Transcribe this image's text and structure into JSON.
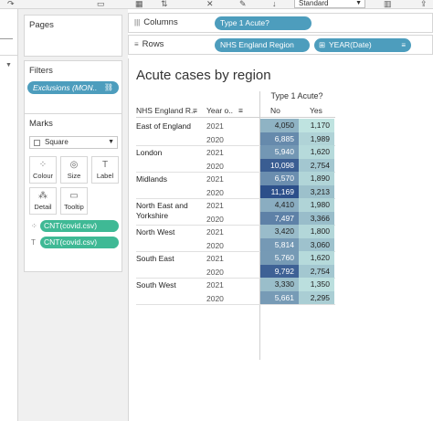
{
  "toolbar": {
    "fit_select": "Standard"
  },
  "cards": {
    "pages_title": "Pages",
    "filters_title": "Filters",
    "filter_pill": "Exclusions (MON..",
    "marks_title": "Marks",
    "mark_type": "Square",
    "buttons": {
      "colour": "Colour",
      "size": "Size",
      "label": "Label",
      "detail": "Detail",
      "tooltip": "Tooltip"
    },
    "mark_pills": [
      "CNT(covid.csv)",
      "CNT(covid.csv)"
    ]
  },
  "shelves": {
    "columns_label": "Columns",
    "rows_label": "Rows",
    "columns_pill": "Type 1 Acute?",
    "rows_pills": [
      "NHS England Region",
      "YEAR(Date)"
    ]
  },
  "viz": {
    "title": "Acute cases by region",
    "top_header": "Type 1 Acute?",
    "col_headers": [
      "NHS England R..",
      "Year o..",
      "No",
      "Yes"
    ],
    "regions": [
      {
        "name": "East of England",
        "rows": [
          {
            "year": "2021",
            "no": "4,050",
            "yes": "1,170"
          },
          {
            "year": "2020",
            "no": "6,885",
            "yes": "1,989"
          }
        ]
      },
      {
        "name": "London",
        "rows": [
          {
            "year": "2021",
            "no": "5,940",
            "yes": "1,620"
          },
          {
            "year": "2020",
            "no": "10,098",
            "yes": "2,754"
          }
        ]
      },
      {
        "name": "Midlands",
        "rows": [
          {
            "year": "2021",
            "no": "6,570",
            "yes": "1,890"
          },
          {
            "year": "2020",
            "no": "11,169",
            "yes": "3,213"
          }
        ]
      },
      {
        "name": "North East and Yorkshire",
        "rows": [
          {
            "year": "2021",
            "no": "4,410",
            "yes": "1,980"
          },
          {
            "year": "2020",
            "no": "7,497",
            "yes": "3,366"
          }
        ]
      },
      {
        "name": "North West",
        "rows": [
          {
            "year": "2021",
            "no": "3,420",
            "yes": "1,800"
          },
          {
            "year": "2020",
            "no": "5,814",
            "yes": "3,060"
          }
        ]
      },
      {
        "name": "South East",
        "rows": [
          {
            "year": "2021",
            "no": "5,760",
            "yes": "1,620"
          },
          {
            "year": "2020",
            "no": "9,792",
            "yes": "2,754"
          }
        ]
      },
      {
        "name": "South West",
        "rows": [
          {
            "year": "2021",
            "no": "3,330",
            "yes": "1,350"
          },
          {
            "year": "2020",
            "no": "5,661",
            "yes": "2,295"
          }
        ]
      }
    ],
    "colors": {
      "low": "#bfe3e0",
      "high": "#2c4f8a",
      "pill_blue": "#4d9dbd",
      "pill_green": "#3fb995"
    }
  }
}
